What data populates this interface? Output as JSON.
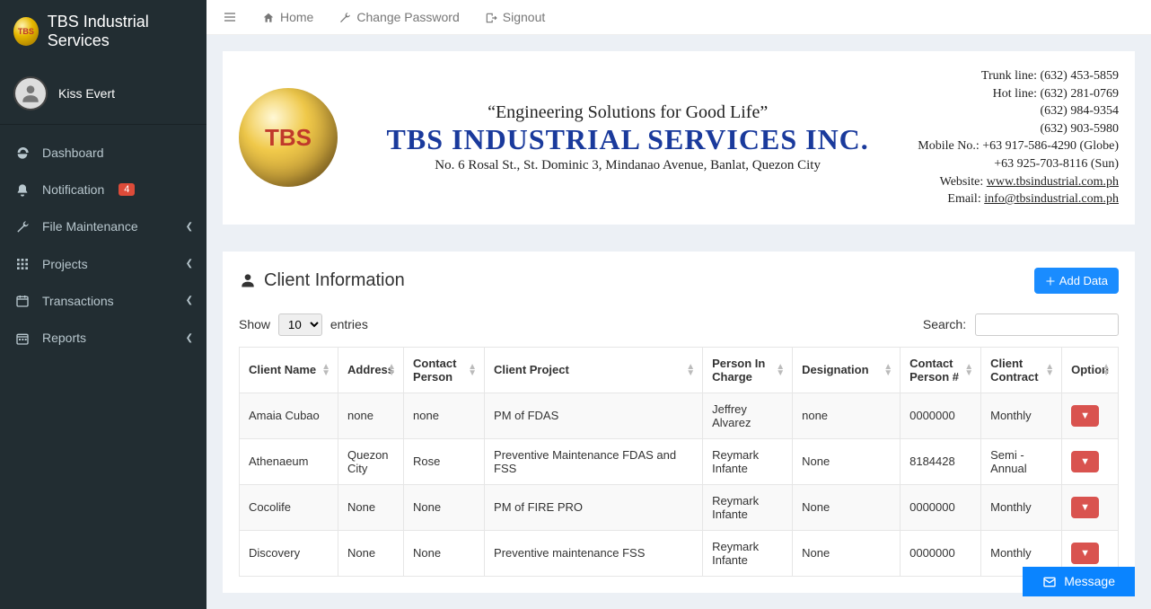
{
  "app": {
    "brand": "TBS Industrial Services",
    "logo_text": "TBS"
  },
  "user": {
    "name": "Kiss Evert"
  },
  "sidebar": {
    "items": [
      {
        "label": "Dashboard",
        "icon": "dashboard-icon",
        "expandable": false
      },
      {
        "label": "Notification",
        "icon": "bell-icon",
        "expandable": false,
        "badge": "4"
      },
      {
        "label": "File Maintenance",
        "icon": "wrench-icon",
        "expandable": true
      },
      {
        "label": "Projects",
        "icon": "grid-icon",
        "expandable": true
      },
      {
        "label": "Transactions",
        "icon": "calendar-icon",
        "expandable": true
      },
      {
        "label": "Reports",
        "icon": "calendar2-icon",
        "expandable": true
      }
    ]
  },
  "topbar": {
    "home": "Home",
    "change_password": "Change Password",
    "signout": "Signout"
  },
  "banner": {
    "logo_text": "TBS",
    "tagline": "“Engineering Solutions for Good Life”",
    "company": "TBS INDUSTRIAL SERVICES INC.",
    "address": "No. 6 Rosal St., St. Dominic 3, Mindanao Avenue, Banlat, Quezon City",
    "contacts": {
      "trunk": "Trunk line: (632) 453-5859",
      "hot": "Hot line: (632) 281-0769",
      "l3": "(632) 984-9354",
      "l4": "(632) 903-5980",
      "mobile1": "Mobile No.: +63 917-586-4290 (Globe)",
      "mobile2": "+63 925-703-8116 (Sun)",
      "website_label": "Website: ",
      "website": "www.tbsindustrial.com.ph",
      "email_label": "Email: ",
      "email": "info@tbsindustrial.com.ph"
    }
  },
  "section": {
    "title": "Client Information",
    "add_button": "Add Data"
  },
  "table": {
    "show_label_pre": "Show",
    "show_label_post": "entries",
    "page_size": "10",
    "search_label": "Search:",
    "search_value": "",
    "columns": [
      "Client Name",
      "Address",
      "Contact Person",
      "Client Project",
      "Person In Charge",
      "Designation",
      "Contact Person #",
      "Client Contract",
      "Option"
    ],
    "rows": [
      {
        "client_name": "Amaia Cubao",
        "address": "none",
        "contact_person": "none",
        "client_project": "PM of FDAS",
        "pic": "Jeffrey Alvarez",
        "designation": "none",
        "contact_num": "0000000",
        "contract": "Monthly"
      },
      {
        "client_name": "Athenaeum",
        "address": "Quezon City",
        "contact_person": "Rose",
        "client_project": "Preventive Maintenance FDAS and FSS",
        "pic": "Reymark Infante",
        "designation": "None",
        "contact_num": "8184428",
        "contract": "Semi - Annual"
      },
      {
        "client_name": "Cocolife",
        "address": "None",
        "contact_person": "None",
        "client_project": "PM of FIRE PRO",
        "pic": "Reymark Infante",
        "designation": "None",
        "contact_num": "0000000",
        "contract": "Monthly"
      },
      {
        "client_name": "Discovery",
        "address": "None",
        "contact_person": "None",
        "client_project": "Preventive maintenance FSS",
        "pic": "Reymark Infante",
        "designation": "None",
        "contact_num": "0000000",
        "contract": "Monthly"
      }
    ]
  },
  "message_button": "Message"
}
